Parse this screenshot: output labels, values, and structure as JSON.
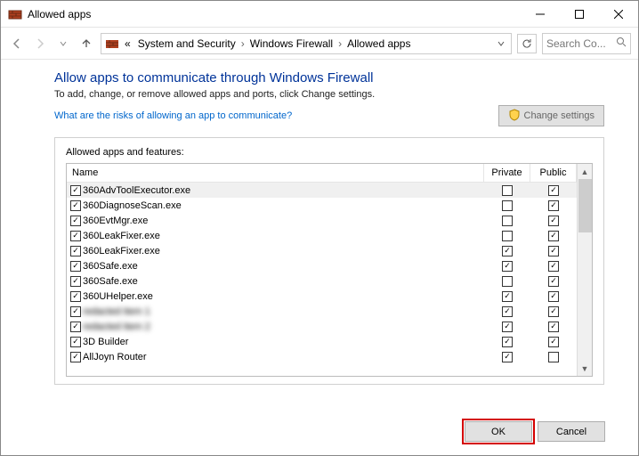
{
  "window": {
    "title": "Allowed apps"
  },
  "breadcrumbs": {
    "prefix": "«",
    "items": [
      "System and Security",
      "Windows Firewall",
      "Allowed apps"
    ]
  },
  "search": {
    "placeholder": "Search Co..."
  },
  "page": {
    "heading": "Allow apps to communicate through Windows Firewall",
    "subtext": "To add, change, or remove allowed apps and ports, click Change settings.",
    "risk_link": "What are the risks of allowing an app to communicate?",
    "change_settings_label": "Change settings",
    "group_label": "Allowed apps and features:",
    "columns": {
      "name": "Name",
      "private": "Private",
      "public": "Public"
    }
  },
  "apps": [
    {
      "name": "360AdvToolExecutor.exe",
      "enabled": true,
      "private": false,
      "public": true,
      "selected": true,
      "blurred": false
    },
    {
      "name": "360DiagnoseScan.exe",
      "enabled": true,
      "private": false,
      "public": true,
      "selected": false,
      "blurred": false
    },
    {
      "name": "360EvtMgr.exe",
      "enabled": true,
      "private": false,
      "public": true,
      "selected": false,
      "blurred": false
    },
    {
      "name": "360LeakFixer.exe",
      "enabled": true,
      "private": false,
      "public": true,
      "selected": false,
      "blurred": false
    },
    {
      "name": "360LeakFixer.exe",
      "enabled": true,
      "private": true,
      "public": true,
      "selected": false,
      "blurred": false
    },
    {
      "name": "360Safe.exe",
      "enabled": true,
      "private": true,
      "public": true,
      "selected": false,
      "blurred": false
    },
    {
      "name": "360Safe.exe",
      "enabled": true,
      "private": false,
      "public": true,
      "selected": false,
      "blurred": false
    },
    {
      "name": "360UHelper.exe",
      "enabled": true,
      "private": true,
      "public": true,
      "selected": false,
      "blurred": false
    },
    {
      "name": "redacted item 1",
      "enabled": true,
      "private": true,
      "public": true,
      "selected": false,
      "blurred": true
    },
    {
      "name": "redacted item 2",
      "enabled": true,
      "private": true,
      "public": true,
      "selected": false,
      "blurred": true
    },
    {
      "name": "3D Builder",
      "enabled": true,
      "private": true,
      "public": true,
      "selected": false,
      "blurred": false
    },
    {
      "name": "AllJoyn Router",
      "enabled": true,
      "private": true,
      "public": false,
      "selected": false,
      "blurred": false
    }
  ],
  "buttons": {
    "ok": "OK",
    "cancel": "Cancel"
  }
}
